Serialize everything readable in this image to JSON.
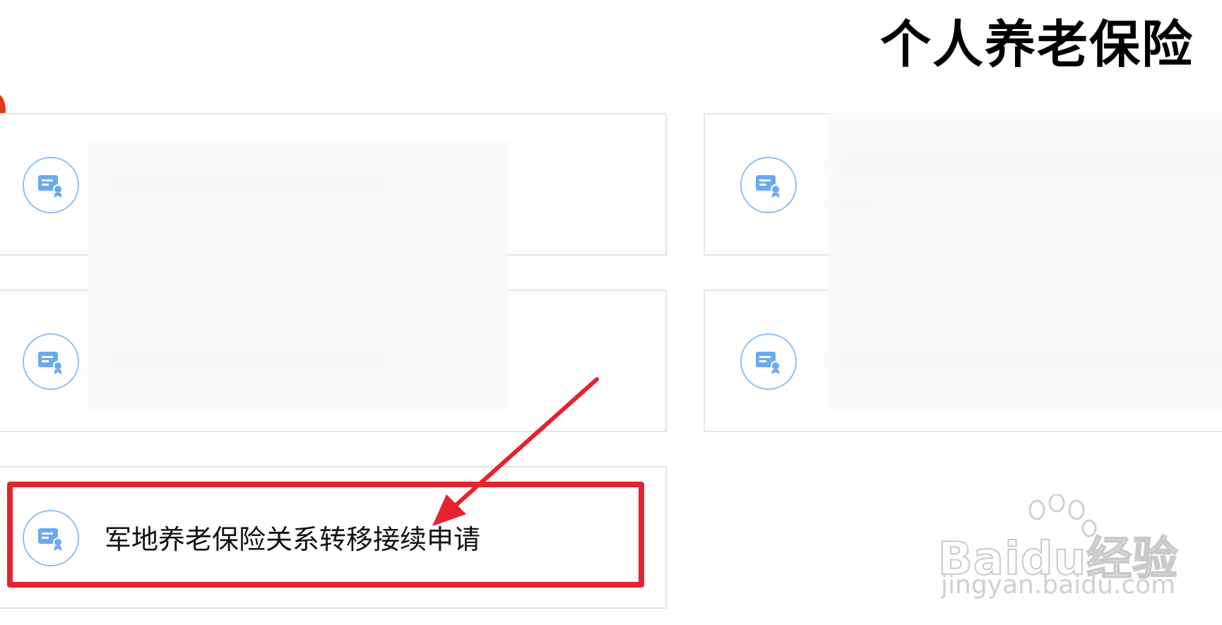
{
  "page": {
    "title": "个人养老保险"
  },
  "services": [
    {
      "label": "",
      "icon": "certificate-icon",
      "blurred": true
    },
    {
      "label": "",
      "icon": "certificate-icon",
      "blurred": true
    },
    {
      "label": "",
      "icon": "certificate-icon",
      "blurred": true
    },
    {
      "label": "",
      "icon": "certificate-icon",
      "blurred": true
    },
    {
      "label": "军地养老保险关系转移接续申请",
      "icon": "certificate-icon",
      "blurred": false,
      "highlighted": true
    }
  ],
  "annotation": {
    "highlight_color": "#e5222d",
    "arrow_color": "#e5222d"
  },
  "colors": {
    "icon_blue": "#6aaaf0",
    "icon_ring": "#8fbfee",
    "card_border": "#e4e4e4",
    "badge": "#e23a1d"
  },
  "watermark": {
    "brand": "Baidu经验",
    "url": "jingyan.baidu.com"
  }
}
